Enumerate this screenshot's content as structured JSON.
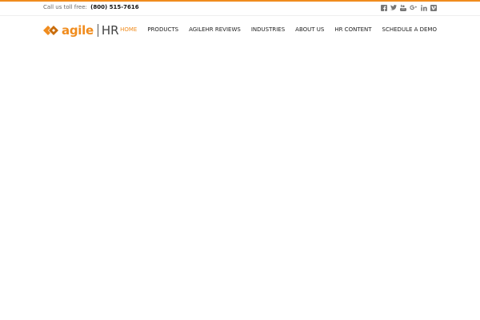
{
  "topbar": {
    "callus_label": "Call us toll free:",
    "phone": "(800) 515-7616",
    "social": [
      {
        "icon": "facebook-icon"
      },
      {
        "icon": "twitter-icon"
      },
      {
        "icon": "youtube-icon"
      },
      {
        "icon": "google-plus-icon"
      },
      {
        "icon": "linkedin-icon"
      },
      {
        "icon": "vimeo-icon"
      }
    ]
  },
  "logo": {
    "word": "agile",
    "hr": "HR"
  },
  "nav": {
    "items": [
      {
        "label": "HOME",
        "active": true
      },
      {
        "label": "PRODUCTS",
        "active": false
      },
      {
        "label": "AGILEHR REVIEWS",
        "active": false
      },
      {
        "label": "INDUSTRIES",
        "active": false
      },
      {
        "label": "ABOUT US",
        "active": false
      },
      {
        "label": "HR CONTENT",
        "active": false
      },
      {
        "label": "SCHEDULE A DEMO",
        "active": false
      }
    ]
  },
  "colors": {
    "accent": "#f08c1e",
    "nav_text": "#222222",
    "icon": "#777777"
  }
}
